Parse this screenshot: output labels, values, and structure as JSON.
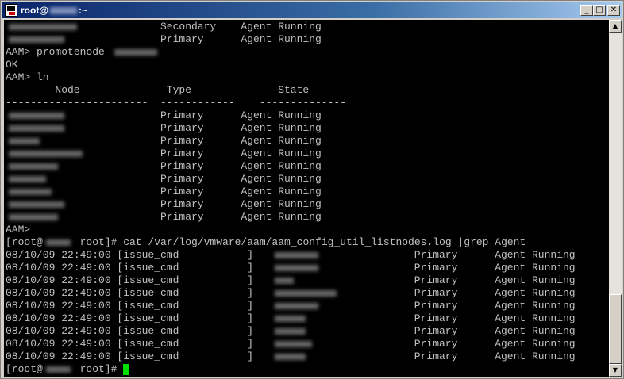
{
  "window": {
    "title_prefix": "root@",
    "title_suffix": ":~",
    "host_redacted": true
  },
  "controls": {
    "minimize": "_",
    "maximize": "□",
    "close": "✕"
  },
  "scrollbar": {
    "up": "▲",
    "down": "▼"
  },
  "terminal": {
    "lines": [
      {
        "segs": [
          {
            "col": 0,
            "text": "",
            "blur": 12
          },
          {
            "col": 25,
            "text": "Secondary"
          },
          {
            "col": 38,
            "text": "Agent Running"
          }
        ]
      },
      {
        "segs": [
          {
            "col": 0,
            "text": "",
            "blur": 10
          },
          {
            "col": 25,
            "text": "Primary"
          },
          {
            "col": 38,
            "text": "Agent Running"
          }
        ]
      },
      {
        "segs": [
          {
            "col": 0,
            "text": "AAM> promotenode "
          },
          {
            "col": 17,
            "text": "",
            "blur": 8
          }
        ]
      },
      {
        "segs": [
          {
            "col": 0,
            "text": "OK"
          }
        ]
      },
      {
        "segs": [
          {
            "col": 0,
            "text": "AAM> ln"
          }
        ]
      },
      {
        "segs": [
          {
            "col": 8,
            "text": "Node"
          },
          {
            "col": 26,
            "text": "Type"
          },
          {
            "col": 44,
            "text": "State"
          }
        ]
      },
      {
        "segs": [
          {
            "col": 0,
            "text": "-----------------------"
          },
          {
            "col": 25,
            "text": "------------"
          },
          {
            "col": 41,
            "text": "--------------"
          }
        ]
      },
      {
        "segs": [
          {
            "col": 0,
            "text": "",
            "blur": 10
          },
          {
            "col": 25,
            "text": "Primary"
          },
          {
            "col": 38,
            "text": "Agent Running"
          }
        ]
      },
      {
        "segs": [
          {
            "col": 0,
            "text": "",
            "blur": 10
          },
          {
            "col": 25,
            "text": "Primary"
          },
          {
            "col": 38,
            "text": "Agent Running"
          }
        ]
      },
      {
        "segs": [
          {
            "col": 0,
            "text": "",
            "blur": 6
          },
          {
            "col": 25,
            "text": "Primary"
          },
          {
            "col": 38,
            "text": "Agent Running"
          }
        ]
      },
      {
        "segs": [
          {
            "col": 0,
            "text": "",
            "blur": 13
          },
          {
            "col": 25,
            "text": "Primary"
          },
          {
            "col": 38,
            "text": "Agent Running"
          }
        ]
      },
      {
        "segs": [
          {
            "col": 0,
            "text": "",
            "blur": 9
          },
          {
            "col": 25,
            "text": "Primary"
          },
          {
            "col": 38,
            "text": "Agent Running"
          }
        ]
      },
      {
        "segs": [
          {
            "col": 0,
            "text": "",
            "blur": 7
          },
          {
            "col": 25,
            "text": "Primary"
          },
          {
            "col": 38,
            "text": "Agent Running"
          }
        ]
      },
      {
        "segs": [
          {
            "col": 0,
            "text": "",
            "blur": 8
          },
          {
            "col": 25,
            "text": "Primary"
          },
          {
            "col": 38,
            "text": "Agent Running"
          }
        ]
      },
      {
        "segs": [
          {
            "col": 0,
            "text": "",
            "blur": 10
          },
          {
            "col": 25,
            "text": "Primary"
          },
          {
            "col": 38,
            "text": "Agent Running"
          }
        ]
      },
      {
        "segs": [
          {
            "col": 0,
            "text": "",
            "blur": 9
          },
          {
            "col": 25,
            "text": "Primary"
          },
          {
            "col": 38,
            "text": "Agent Running"
          }
        ]
      },
      {
        "segs": [
          {
            "col": 0,
            "text": "AAM>"
          }
        ]
      },
      {
        "segs": [
          {
            "col": 0,
            "text": "[root@"
          },
          {
            "col": 6,
            "text": "",
            "blur": 5
          },
          {
            "col": 12,
            "text": "root]# cat /var/log/vmware/aam/aam_config_util_listnodes.log |grep Agent"
          }
        ]
      },
      {
        "segs": [
          {
            "col": 0,
            "text": "08/10/09 22:49:00 [issue_cmd"
          },
          {
            "col": 39,
            "text": "]"
          },
          {
            "col": 43,
            "text": "",
            "blur": 8
          },
          {
            "col": 66,
            "text": "Primary"
          },
          {
            "col": 79,
            "text": "Agent Running"
          }
        ]
      },
      {
        "segs": [
          {
            "col": 0,
            "text": "08/10/09 22:49:00 [issue_cmd"
          },
          {
            "col": 39,
            "text": "]"
          },
          {
            "col": 43,
            "text": "",
            "blur": 8
          },
          {
            "col": 66,
            "text": "Primary"
          },
          {
            "col": 79,
            "text": "Agent Running"
          }
        ]
      },
      {
        "segs": [
          {
            "col": 0,
            "text": "08/10/09 22:49:00 [issue_cmd"
          },
          {
            "col": 39,
            "text": "]"
          },
          {
            "col": 43,
            "text": "",
            "blur": 4
          },
          {
            "col": 66,
            "text": "Primary"
          },
          {
            "col": 79,
            "text": "Agent Running"
          }
        ]
      },
      {
        "segs": [
          {
            "col": 0,
            "text": "08/10/09 22:49:00 [issue_cmd"
          },
          {
            "col": 39,
            "text": "]"
          },
          {
            "col": 43,
            "text": "",
            "blur": 11
          },
          {
            "col": 66,
            "text": "Primary"
          },
          {
            "col": 79,
            "text": "Agent Running"
          }
        ]
      },
      {
        "segs": [
          {
            "col": 0,
            "text": "08/10/09 22:49:00 [issue_cmd"
          },
          {
            "col": 39,
            "text": "]"
          },
          {
            "col": 43,
            "text": "",
            "blur": 8
          },
          {
            "col": 66,
            "text": "Primary"
          },
          {
            "col": 79,
            "text": "Agent Running"
          }
        ]
      },
      {
        "segs": [
          {
            "col": 0,
            "text": "08/10/09 22:49:00 [issue_cmd"
          },
          {
            "col": 39,
            "text": "]"
          },
          {
            "col": 43,
            "text": "",
            "blur": 6
          },
          {
            "col": 66,
            "text": "Primary"
          },
          {
            "col": 79,
            "text": "Agent Running"
          }
        ]
      },
      {
        "segs": [
          {
            "col": 0,
            "text": "08/10/09 22:49:00 [issue_cmd"
          },
          {
            "col": 39,
            "text": "]"
          },
          {
            "col": 43,
            "text": "",
            "blur": 6
          },
          {
            "col": 66,
            "text": "Primary"
          },
          {
            "col": 79,
            "text": "Agent Running"
          }
        ]
      },
      {
        "segs": [
          {
            "col": 0,
            "text": "08/10/09 22:49:00 [issue_cmd"
          },
          {
            "col": 39,
            "text": "]"
          },
          {
            "col": 43,
            "text": "",
            "blur": 7
          },
          {
            "col": 66,
            "text": "Primary"
          },
          {
            "col": 79,
            "text": "Agent Running"
          }
        ]
      },
      {
        "segs": [
          {
            "col": 0,
            "text": "08/10/09 22:49:00 [issue_cmd"
          },
          {
            "col": 39,
            "text": "]"
          },
          {
            "col": 43,
            "text": "",
            "blur": 6
          },
          {
            "col": 66,
            "text": "Primary"
          },
          {
            "col": 79,
            "text": "Agent Running"
          }
        ]
      },
      {
        "segs": [
          {
            "col": 0,
            "text": "[root@"
          },
          {
            "col": 6,
            "text": "",
            "blur": 5
          },
          {
            "col": 12,
            "text": "root]# "
          }
        ],
        "cursor": true
      }
    ]
  },
  "colors": {
    "terminal_bg": "#000000",
    "terminal_fg": "#c0c0c0",
    "cursor": "#00e000",
    "titlebar": "#0a246a"
  }
}
